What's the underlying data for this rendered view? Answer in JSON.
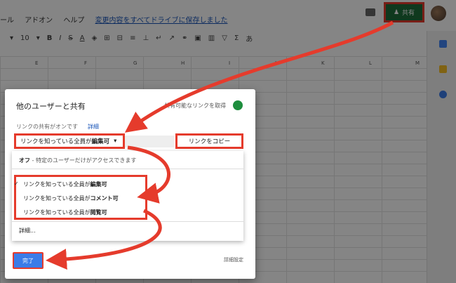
{
  "menubar": {
    "tools": "ール",
    "addons": "アドオン",
    "help": "ヘルプ",
    "saved": "変更内容をすべてドライブに保存しました"
  },
  "share": {
    "label": "共有"
  },
  "toolbar": {
    "font_size": "10",
    "bold": "B",
    "italic": "I",
    "strike": "S",
    "text_color": "A",
    "func": "Σ",
    "input": "あ"
  },
  "columns": [
    "E",
    "F",
    "G",
    "H",
    "I",
    "J",
    "K",
    "L",
    "M"
  ],
  "dialog": {
    "title": "他のユーザーと共有",
    "get_link": "共有可能なリンクを取得",
    "status": "リンクの共有がオンです",
    "details": "詳細",
    "permission_prefix": "リンクを知っている全員が",
    "permission_bold": "編集可",
    "copy_link": "リンクをコピー",
    "options": {
      "off_bold": "オフ",
      "off_desc": " - 特定のユーザーだけがアクセスできます",
      "edit_prefix": "リンクを知っている全員が",
      "edit_bold": "編集可",
      "comment_prefix": "リンクを知っている全員が",
      "comment_bold": "コメント可",
      "view_prefix": "リンクを知っている全員が",
      "view_bold": "閲覧可",
      "more": "詳細..."
    },
    "done": "完了",
    "advanced": "詳細設定"
  },
  "colors": {
    "share_bg": "#1e6e3a",
    "highlight": "#e53b2c",
    "done_bg": "#3b7ce8"
  }
}
